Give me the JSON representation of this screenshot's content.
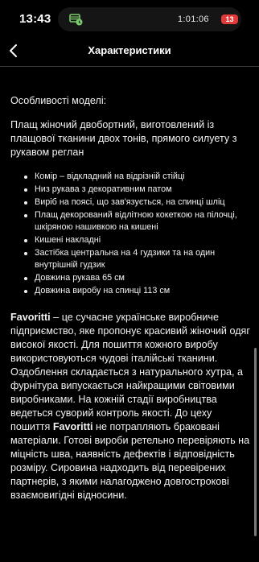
{
  "status": {
    "time": "13:43",
    "recording_time": "1:01:06",
    "battery": "13",
    "colors": {
      "battery_badge": "#e03a3a",
      "recording_icon": "#7bcf6a"
    }
  },
  "nav": {
    "title": "Характеристики",
    "back_icon": "chevron-left-icon"
  },
  "content": {
    "section_title": "Особливості моделі:",
    "description": "Плащ жіночий двобортний, виготовлений із плащової тканини двох тонів, прямого силуету з рукавом реглан",
    "features": [
      "Комір – відкладний на відрізній стійці",
      "Низ рукава з декоративним патом",
      "Виріб на поясі, що зав'язується, на спинці шліц",
      "Плащ декорований відлітною кокеткою на пілочці, шкіряною нашивкою на кишені",
      "Кишені накладні",
      "Застібка центральна на 4 гудзики та на один внутрішній гудзик",
      "Довжина рукава 65 см",
      "Довжина виробу на спинці 113 см"
    ],
    "brand_name": "Favoritti",
    "brand_text_1": " – це сучасне українське виробниче підприємство, яке пропонує красивий жіночий одяг високої якості. Для пошиття кожного виробу використовуються чудові італійські тканини. Оздоблення складається з натурального хутра, а фурнітура випускається найкращими світовими виробниками. На кожній стадії виробництва ведеться суворий контроль якості. До цеху пошиття ",
    "brand_name_2": "Favoritti",
    "brand_text_2": " не потрапляють браковані матеріали. Готові вироби ретельно перевіряють на міцність шва, наявність дефектів і відповідність розміру. Сировина надходить від перевірених партнерів, з якими налагоджено довгострокові взаємовигідні відносини."
  }
}
